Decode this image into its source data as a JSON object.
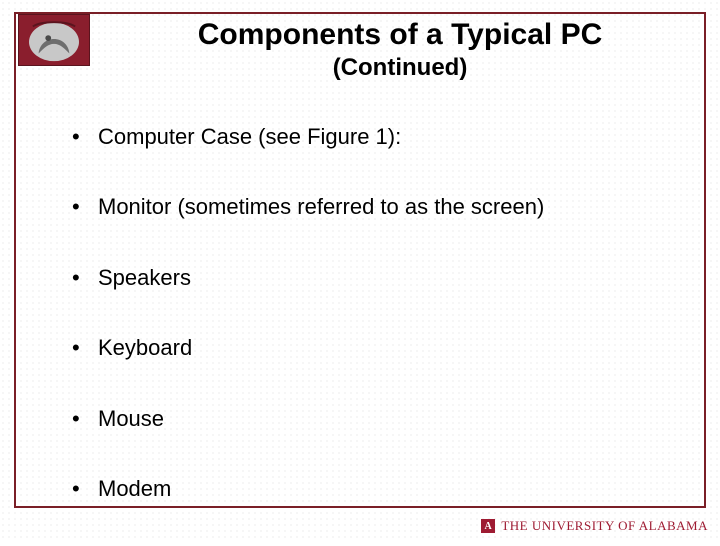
{
  "title": "Components of a Typical PC",
  "subtitle": "(Continued)",
  "bullets": [
    "Computer Case (see Figure 1):",
    "Monitor (sometimes referred to as the screen)",
    "Speakers",
    "Keyboard",
    "Mouse",
    "Modem"
  ],
  "footer": {
    "mark": "A",
    "text": "THE UNIVERSITY OF ALABAMA"
  }
}
